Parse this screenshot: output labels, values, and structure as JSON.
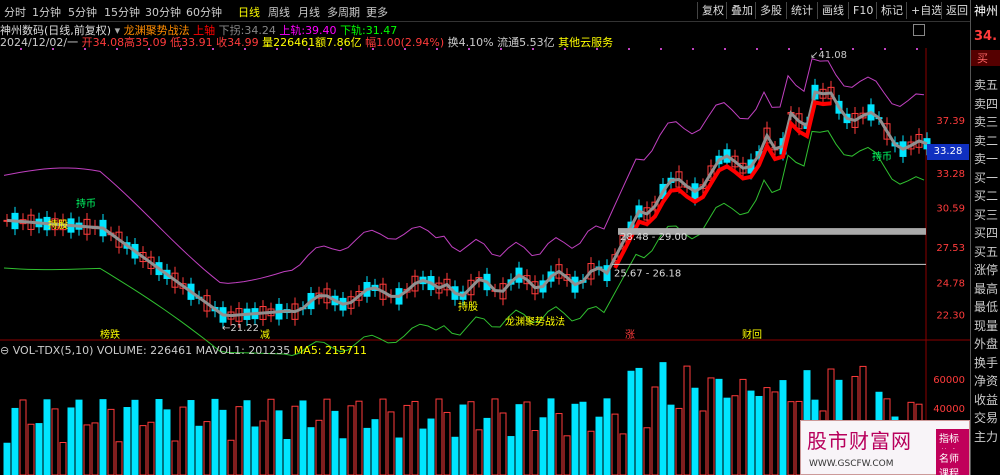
{
  "timeframes": [
    {
      "label": "分时",
      "active": false
    },
    {
      "label": "1分钟",
      "active": false
    },
    {
      "label": "5分钟",
      "active": false
    },
    {
      "label": "15分钟",
      "active": false
    },
    {
      "label": "30分钟",
      "active": false
    },
    {
      "label": "60分钟",
      "active": false
    },
    {
      "label": "日线",
      "active": true
    },
    {
      "label": "周线",
      "active": false
    },
    {
      "label": "月线",
      "active": false
    },
    {
      "label": "多周期",
      "active": false
    },
    {
      "label": "更多",
      "active": false
    }
  ],
  "toolbar": [
    "复权",
    "叠加",
    "多股",
    "统计",
    "画线",
    "F10",
    "标记",
    "+自选",
    "返回"
  ],
  "info1": {
    "name": "神州数码(日线,前复权)",
    "indicator": "龙渊聚势战法",
    "up": "上轴",
    "down_label": "下拐:",
    "down_val": "34.24",
    "up_label": "上轨:",
    "up_val": "39.40",
    "low_label": "下轨:",
    "low_val": "31.47"
  },
  "info2": {
    "date": "2024/12/02/一",
    "open": "开34.08",
    "high": "高35.09",
    "low": "低33.91",
    "close": "收34.99",
    "vol": "量226461",
    "amt": "额7.86亿",
    "chg": "幅1.00(2.94%)",
    "turn": "换4.10%",
    "float": "流通5.53亿",
    "svc": "其他云服务"
  },
  "volinfo": {
    "name": "VOL-TDX(5,10)",
    "volume": "VOLUME: 226461",
    "mavol": "MAVOL1: 201235",
    "ma5": "MA5: 215711"
  },
  "price_axis": [
    "37.39",
    "33.28",
    "30.59",
    "27.53",
    "24.78",
    "22.30"
  ],
  "vol_axis": [
    "60000",
    "40000"
  ],
  "annotations": {
    "high": "41.08",
    "low": "21.22",
    "zone1": "28.48 - 29.00",
    "zone2": "25.67 - 26.18",
    "label1": "持股",
    "label2": "持币",
    "label3": "持股",
    "label4": "龙渊聚势战法",
    "label5": "持币",
    "ev1": "榜跌",
    "ev2": "减",
    "ev3": "涨",
    "ev4": "财回",
    "price_tag": "33.28"
  },
  "rpanel": {
    "name": "神州",
    "price": "34.",
    "buy": "买",
    "items": [
      "卖五",
      "卖四",
      "卖三",
      "卖二",
      "卖一",
      "买一",
      "买二",
      "买三",
      "买四",
      "买五",
      "涨停",
      "最高",
      "最低",
      "现量",
      "外盘",
      "换手",
      "净资",
      "收益",
      "交易",
      "主力"
    ]
  },
  "watermark": {
    "title": "股市财富网",
    "btn1": "指标分享",
    "btn2": "名师课程",
    "url": "WWW.GSCFW.COM"
  }
}
